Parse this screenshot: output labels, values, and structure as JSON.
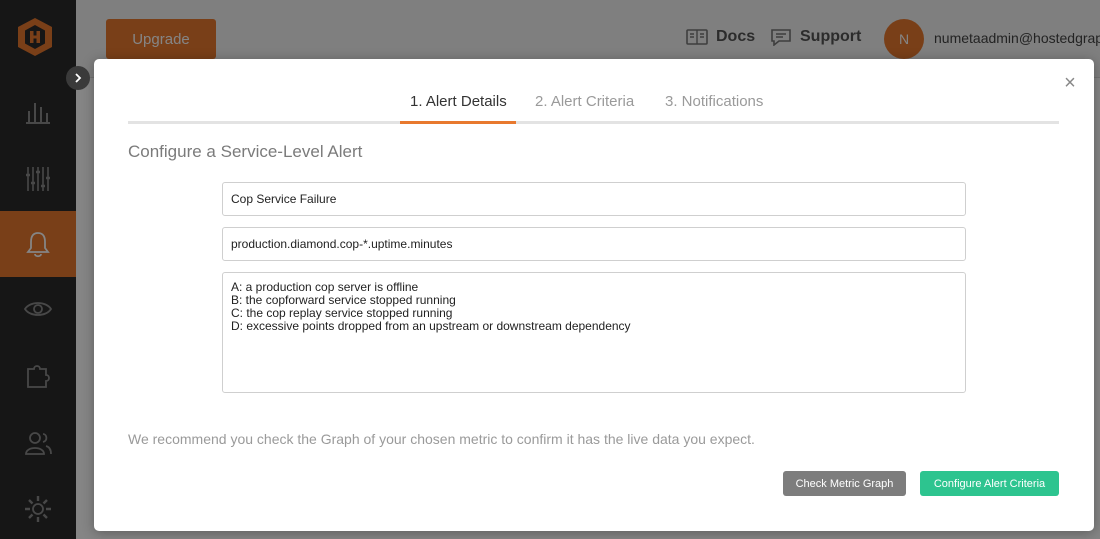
{
  "app": {
    "upgrade_label": "Upgrade",
    "docs_label": "Docs",
    "support_label": "Support",
    "avatar_initial": "N",
    "user_email": "numetaadmin@hostedgraph",
    "accent_color": "#e8792f",
    "sidebar_icons": [
      "dashboard-icon",
      "metrics-icon",
      "bell-icon",
      "eye-icon",
      "puzzle-icon",
      "users-icon",
      "gear-icon"
    ],
    "active_sidebar_item": "bell-icon"
  },
  "modal": {
    "close_label": "×",
    "tabs": [
      {
        "label": "1. Alert Details",
        "active": true
      },
      {
        "label": "2. Alert Criteria",
        "active": false
      },
      {
        "label": "3. Notifications",
        "active": false
      }
    ],
    "section_title": "Configure a Service-Level Alert",
    "fields": {
      "alert_name": "Cop Service Failure",
      "metric": "production.diamond.cop-*.uptime.minutes",
      "description": "A: a production cop server is offline\nB: the copforward service stopped running\nC: the cop replay service stopped running\nD: excessive points dropped from an upstream or downstream dependency"
    },
    "recommendation": "We recommend you check the Graph of your chosen metric to confirm it has the live data you expect.",
    "check_graph_label": "Check Metric Graph",
    "configure_criteria_label": "Configure Alert Criteria",
    "primary_color": "#2dc48f",
    "secondary_color": "#7d7d7d"
  }
}
